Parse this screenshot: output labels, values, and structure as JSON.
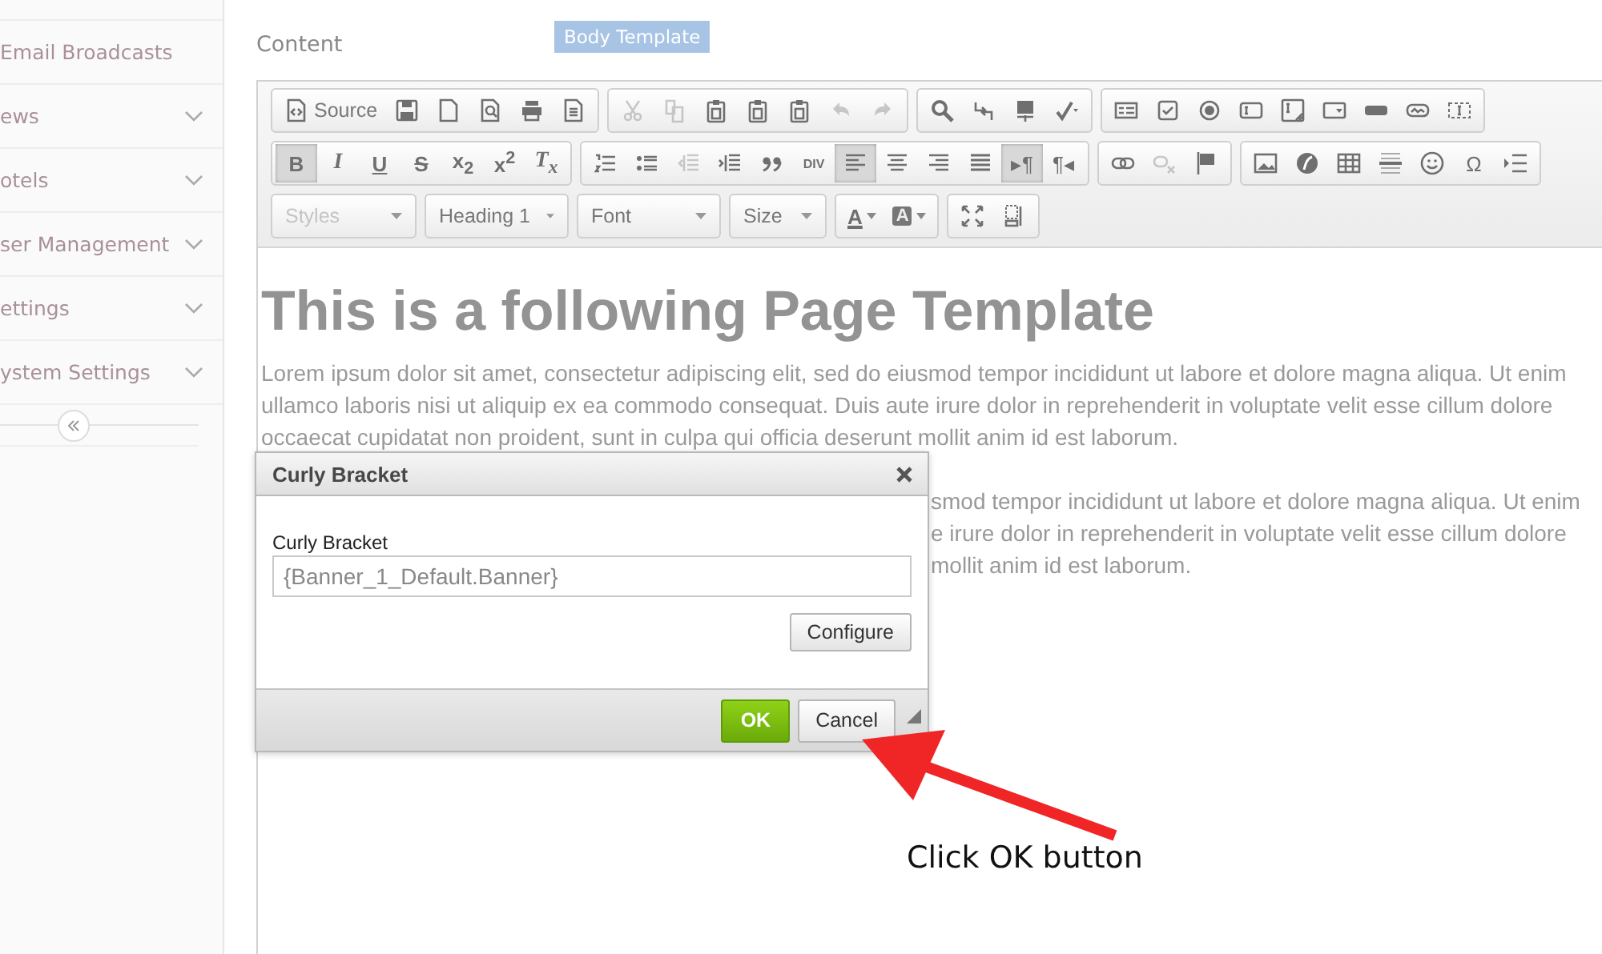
{
  "sidebar": {
    "items": [
      {
        "label": "Email Broadcasts",
        "expandable": false
      },
      {
        "label": "ews",
        "expandable": true
      },
      {
        "label": "otels",
        "expandable": true
      },
      {
        "label": "ser Management",
        "expandable": true
      },
      {
        "label": "ettings",
        "expandable": true
      },
      {
        "label": "ystem Settings",
        "expandable": true
      }
    ]
  },
  "content_label": "Content",
  "template_badge": "Body Template",
  "toolbar": {
    "rows": [
      {
        "groups": [
          {
            "buttons": [
              {
                "kind": "source",
                "label": "Source",
                "pressed": false,
                "disabled": false
              },
              {
                "kind": "save",
                "pressed": false,
                "disabled": false
              },
              {
                "kind": "newpage",
                "pressed": false,
                "disabled": false
              },
              {
                "kind": "preview",
                "pressed": false,
                "disabled": false
              },
              {
                "kind": "print",
                "pressed": false,
                "disabled": false
              },
              {
                "kind": "templates",
                "pressed": false,
                "disabled": false
              }
            ]
          },
          {
            "buttons": [
              {
                "kind": "cut",
                "pressed": false,
                "disabled": true
              },
              {
                "kind": "copy",
                "pressed": false,
                "disabled": true
              },
              {
                "kind": "paste",
                "pressed": false,
                "disabled": false
              },
              {
                "kind": "paste",
                "pressed": false,
                "disabled": false
              },
              {
                "kind": "paste",
                "pressed": false,
                "disabled": false
              },
              {
                "kind": "undo",
                "pressed": false,
                "disabled": true
              },
              {
                "kind": "redo",
                "pressed": false,
                "disabled": true
              }
            ]
          },
          {
            "buttons": [
              {
                "kind": "find",
                "pressed": false,
                "disabled": false
              },
              {
                "kind": "replace",
                "pressed": false,
                "disabled": false
              },
              {
                "kind": "selectall",
                "pressed": false,
                "disabled": false
              },
              {
                "kind": "spellcheck",
                "pressed": false,
                "disabled": false
              }
            ]
          },
          {
            "buttons": [
              {
                "kind": "form",
                "pressed": false,
                "disabled": false
              },
              {
                "kind": "checkbox",
                "pressed": false,
                "disabled": false
              },
              {
                "kind": "radio",
                "pressed": false,
                "disabled": false
              },
              {
                "kind": "textfield",
                "pressed": false,
                "disabled": false
              },
              {
                "kind": "textarea",
                "pressed": false,
                "disabled": false
              },
              {
                "kind": "select",
                "pressed": false,
                "disabled": false
              },
              {
                "kind": "button",
                "pressed": false,
                "disabled": false
              },
              {
                "kind": "imagebutton",
                "pressed": false,
                "disabled": false
              },
              {
                "kind": "hiddenfield",
                "pressed": false,
                "disabled": false
              }
            ]
          }
        ]
      },
      {
        "groups": [
          {
            "buttons": [
              {
                "kind": "bold",
                "glyph": "B",
                "pressed": true,
                "disabled": false
              },
              {
                "kind": "italic",
                "glyph": "I",
                "pressed": false,
                "disabled": false
              },
              {
                "kind": "underline",
                "glyph": "U",
                "pressed": false,
                "disabled": false
              },
              {
                "kind": "strike",
                "glyph": "S",
                "pressed": false,
                "disabled": false
              },
              {
                "kind": "subscript",
                "glyph": "x$_{2}$",
                "pressed": false,
                "disabled": false
              },
              {
                "kind": "superscript",
                "glyph": "x$^{2}$",
                "pressed": false,
                "disabled": false
              },
              {
                "kind": "removeformat",
                "glyph": "T$_{x}$",
                "pressed": false,
                "disabled": false
              }
            ]
          },
          {
            "buttons": [
              {
                "kind": "numlist",
                "pressed": false,
                "disabled": false
              },
              {
                "kind": "bulletlist",
                "pressed": false,
                "disabled": false
              },
              {
                "kind": "outdent",
                "pressed": false,
                "disabled": true
              },
              {
                "kind": "indent",
                "pressed": false,
                "disabled": false
              },
              {
                "kind": "blockquote",
                "pressed": false,
                "disabled": false
              },
              {
                "kind": "div",
                "glyph": "DIV",
                "pressed": false,
                "disabled": false
              },
              {
                "kind": "alignleft",
                "pressed": true,
                "disabled": false
              },
              {
                "kind": "aligncenter",
                "pressed": false,
                "disabled": false
              },
              {
                "kind": "alignright",
                "pressed": false,
                "disabled": false
              },
              {
                "kind": "justify",
                "pressed": false,
                "disabled": false
              },
              {
                "kind": "ltr",
                "glyph": "▸¶",
                "pressed": true,
                "disabled": false
              },
              {
                "kind": "rtl",
                "glyph": "¶◂",
                "pressed": false,
                "disabled": false
              }
            ]
          },
          {
            "buttons": [
              {
                "kind": "link",
                "pressed": false,
                "disabled": false
              },
              {
                "kind": "unlink",
                "pressed": false,
                "disabled": true
              },
              {
                "kind": "anchor",
                "pressed": false,
                "disabled": false
              }
            ]
          },
          {
            "buttons": [
              {
                "kind": "image",
                "pressed": false,
                "disabled": false
              },
              {
                "kind": "flash",
                "pressed": false,
                "disabled": false
              },
              {
                "kind": "table",
                "pressed": false,
                "disabled": false
              },
              {
                "kind": "hr",
                "pressed": false,
                "disabled": false
              },
              {
                "kind": "smiley",
                "pressed": false,
                "disabled": false
              },
              {
                "kind": "specialchar",
                "glyph": "Ω",
                "pressed": false,
                "disabled": false
              },
              {
                "kind": "pagebreak",
                "pressed": false,
                "disabled": false
              }
            ]
          }
        ]
      },
      {
        "groups": [
          {
            "combo": "Styles",
            "disabled": true
          },
          {
            "combo": "Heading 1",
            "disabled": false
          },
          {
            "combo": "Font",
            "disabled": false
          },
          {
            "combo": "Size",
            "disabled": false
          },
          {
            "buttons": [
              {
                "kind": "textcolor",
                "glyph": "A",
                "pressed": false,
                "disabled": false
              },
              {
                "kind": "bgcolor",
                "glyph": "A",
                "pressed": false,
                "disabled": false
              }
            ]
          },
          {
            "buttons": [
              {
                "kind": "maximize",
                "pressed": false,
                "disabled": false
              },
              {
                "kind": "showblocks",
                "pressed": false,
                "disabled": false
              }
            ]
          }
        ]
      }
    ]
  },
  "document": {
    "heading": "This is a following Page Template",
    "paragraphs": [
      {
        "lines": [
          "Lorem ipsum dolor sit amet, consectetur adipiscing elit, sed do eiusmod tempor incididunt ut labore et dolore magna aliqua. Ut enim",
          "ullamco laboris nisi ut aliquip ex ea commodo consequat. Duis aute irure dolor in reprehenderit in voluptate velit esse cillum dolore",
          "occaecat cupidatat non proident, sunt in culpa qui officia deserunt mollit anim id est laborum."
        ]
      },
      {
        "lines": [
          "smod tempor incididunt ut labore et dolore magna aliqua. Ut enim",
          "e irure dolor in reprehenderit in voluptate velit esse cillum dolore",
          "mollit anim id est laborum."
        ]
      }
    ]
  },
  "dialog": {
    "title": "Curly Bracket",
    "field_label": "Curly Bracket",
    "field_value": "{Banner_1_Default.Banner}",
    "configure_button": "Configure",
    "ok_button": "OK",
    "cancel_button": "Cancel"
  },
  "annotation": "Click OK button"
}
